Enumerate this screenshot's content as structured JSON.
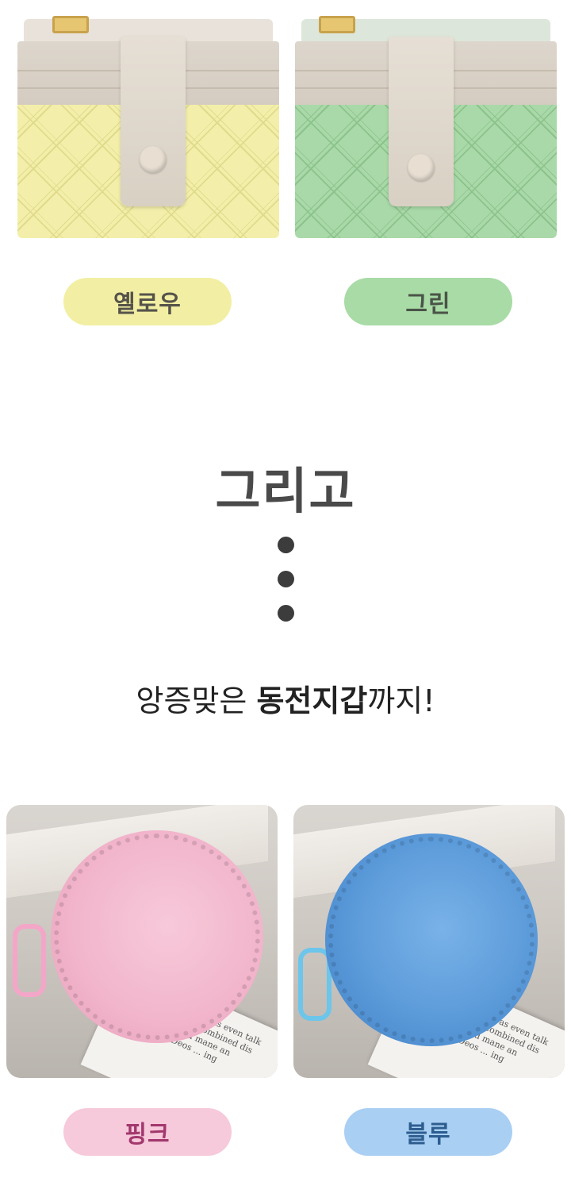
{
  "wallets": [
    {
      "color_name": "옐로우",
      "accent": "#f3efaa",
      "pill_bg": "#f2efa4",
      "pill_text": "#55534a"
    },
    {
      "color_name": "그린",
      "accent": "#a9d9a8",
      "pill_bg": "#a8dba6",
      "pill_text": "#4a5448"
    }
  ],
  "headline": "그리고",
  "subline": {
    "prefix": "앙증맞은 ",
    "bold": "동전지갑",
    "suffix": "까지!"
  },
  "coin_purses": [
    {
      "color_name": "핑크",
      "accent": "#f2b6cc",
      "pill_bg": "#f6c9db",
      "pill_text": "#a2386d",
      "paper_text": [
        "Ben, was even talk",
        "She combined dis",
        "wild mane an",
        "Deos ... ing"
      ]
    },
    {
      "color_name": "블루",
      "accent": "#5b9ad9",
      "pill_bg": "#a9cff3",
      "pill_text": "#2d5d8f",
      "paper_text": [
        "Ben, was even talk",
        "She combined dis",
        "wild mane an",
        "Deos ... ing"
      ]
    }
  ]
}
